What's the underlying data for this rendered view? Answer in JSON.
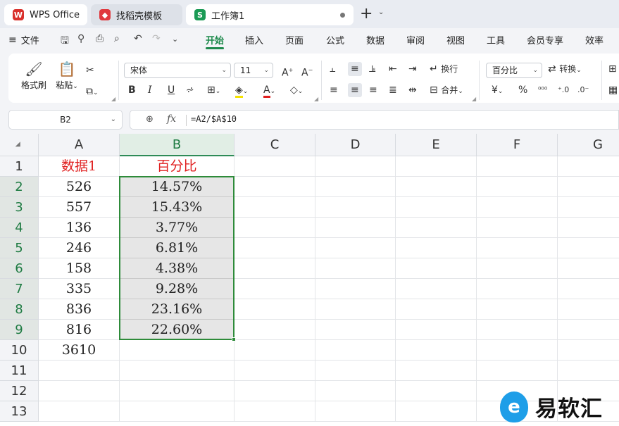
{
  "tabs": [
    {
      "label": "WPS Office",
      "icon": "wps-logo-icon",
      "color": "#d9302b"
    },
    {
      "label": "找稻壳模板",
      "icon": "daoke-logo-icon",
      "color": "#e0383d"
    },
    {
      "label": "工作簿1",
      "icon": "spreadsheet-logo-icon",
      "color": "#1a9a55",
      "logo_text": "S"
    }
  ],
  "menu": {
    "file_label": "文件",
    "items": [
      "开始",
      "插入",
      "页面",
      "公式",
      "数据",
      "审阅",
      "视图",
      "工具",
      "会员专享",
      "效率"
    ],
    "active": "开始",
    "accent_color": "#1e8a4c"
  },
  "ribbon": {
    "format_painter": "格式刷",
    "paste": "粘贴",
    "font_name": "宋体",
    "font_size": "11",
    "wrap_text": "换行",
    "merge": "合并",
    "number_format": "百分比",
    "convert": "转换"
  },
  "formula_bar": {
    "cell_ref": "B2",
    "fx": "fx",
    "formula": "=A2/$A$10"
  },
  "sheet": {
    "columns": [
      "A",
      "B",
      "C",
      "D",
      "E",
      "F",
      "G"
    ],
    "selected_column": "B",
    "rows": [
      "1",
      "2",
      "3",
      "4",
      "5",
      "6",
      "7",
      "8",
      "9",
      "10",
      "11",
      "12",
      "13"
    ],
    "header_color": "#e02020",
    "header_a": "数据1",
    "header_b": "百分比",
    "data_a": [
      "526",
      "557",
      "136",
      "246",
      "158",
      "335",
      "836",
      "816",
      "3610"
    ],
    "data_b": [
      "14.57%",
      "15.43%",
      "3.77%",
      "6.81%",
      "4.38%",
      "9.28%",
      "23.16%",
      "22.60%"
    ]
  },
  "watermark": {
    "text": "易软汇"
  }
}
